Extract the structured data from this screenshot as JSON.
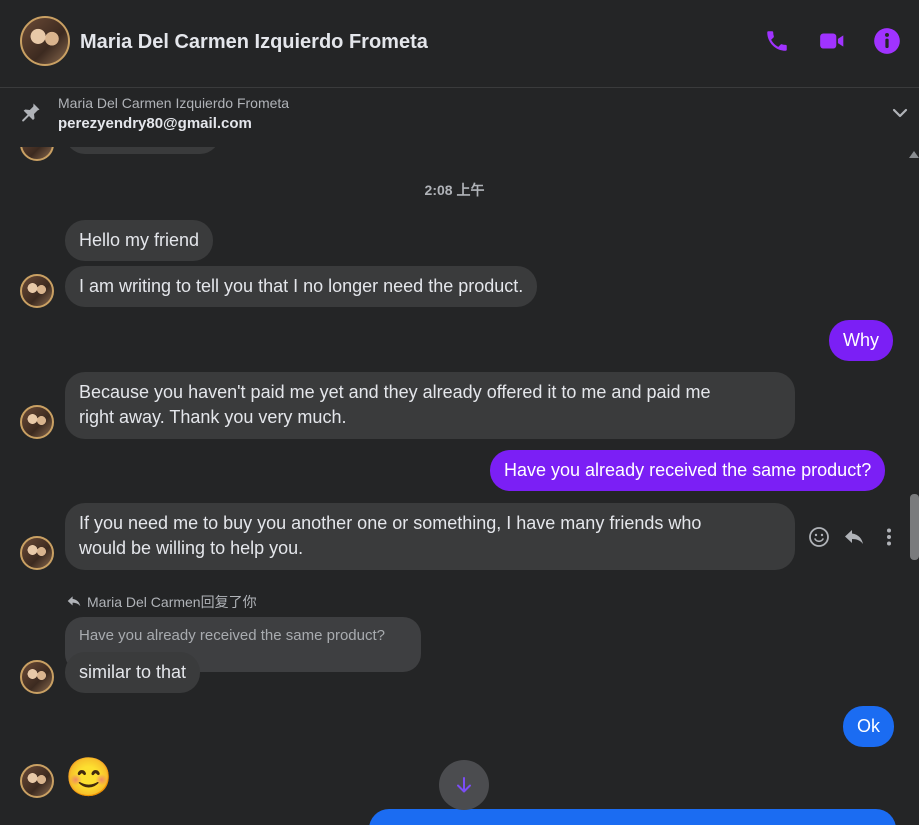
{
  "colors": {
    "accent_purple": "#7b1ff5",
    "accent_blue": "#1b6cf2",
    "icon_purple": "#a033ff",
    "background": "#242526",
    "bubble_other": "#3a3b3c"
  },
  "header": {
    "title": "Maria Del Carmen Izquierdo Frometa",
    "avatar_icon": "avatar",
    "actions": [
      {
        "icon": "phone-icon"
      },
      {
        "icon": "video-camera-icon"
      },
      {
        "icon": "info-icon"
      }
    ]
  },
  "pinned": {
    "icon": "pin-icon",
    "name": "Maria Del Carmen Izquierdo Frometa",
    "email": "perezyendry80@gmail.com",
    "expand_icon": "chevron-down-icon"
  },
  "conversation": {
    "timestamp": "2:08 上午",
    "messages": [
      {
        "sender": "them",
        "text": "Hello my friend"
      },
      {
        "sender": "them",
        "text": "I am writing to tell you that I no longer need the product."
      },
      {
        "sender": "me",
        "text": "Why"
      },
      {
        "sender": "them",
        "text_line1": "Because you haven't paid me yet and they already offered it to me and paid me",
        "text_line2": "right away. Thank you very much."
      },
      {
        "sender": "me",
        "text": "Have you already received the same product?"
      },
      {
        "sender": "them",
        "text_line1": "If you need me to buy you another one or something, I have many friends who",
        "text_line2": "would be willing to help you."
      },
      {
        "sender": "them",
        "reply_label": "Maria Del Carmen回复了你",
        "quoted": "Have you already received the same product?",
        "text": "similar to that"
      },
      {
        "sender": "me",
        "text": "Ok"
      },
      {
        "sender": "them",
        "emoji": "😊"
      }
    ],
    "message_actions": [
      {
        "icon": "smiley-icon"
      },
      {
        "icon": "reply-icon"
      },
      {
        "icon": "more-options-icon"
      }
    ],
    "scroll_down_icon": "arrow-down-icon"
  }
}
